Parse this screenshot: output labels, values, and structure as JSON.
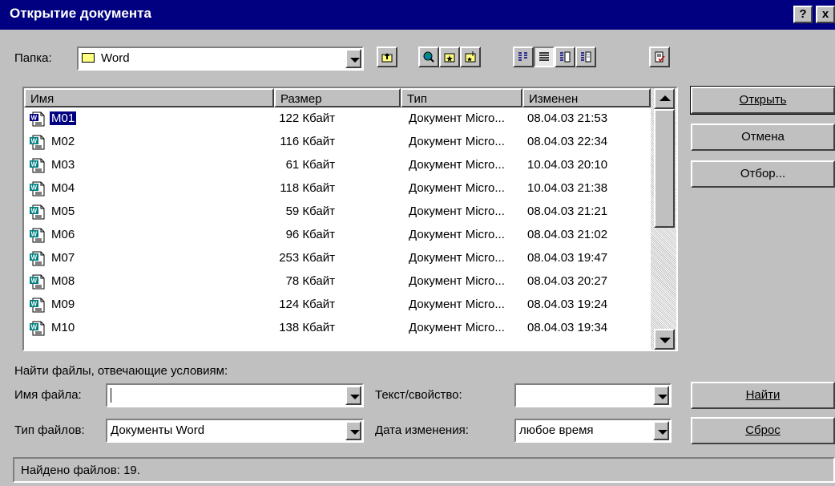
{
  "window": {
    "title": "Открытие документа",
    "help_label": "?",
    "close_label": "x"
  },
  "folder": {
    "label": "Папка:",
    "value": "Word"
  },
  "toolbar": {
    "icons": [
      "up-one-level-icon",
      "search-web-icon",
      "look-in-favorites-icon",
      "add-to-favorites-icon",
      "list-view-icon",
      "details-view-icon",
      "properties-view-icon",
      "preview-view-icon",
      "commands-settings-icon"
    ]
  },
  "file_list": {
    "headers": {
      "name": "Имя",
      "size": "Размер",
      "type": "Тип",
      "modified": "Изменен"
    },
    "rows": [
      {
        "name": "M01",
        "size": "122 Кбайт",
        "type": "Документ Micro...",
        "modified": "08.04.03 21:53",
        "selected": true
      },
      {
        "name": "M02",
        "size": "116 Кбайт",
        "type": "Документ Micro...",
        "modified": "08.04.03 22:34"
      },
      {
        "name": "M03",
        "size": "61 Кбайт",
        "type": "Документ Micro...",
        "modified": "10.04.03 20:10"
      },
      {
        "name": "M04",
        "size": "118 Кбайт",
        "type": "Документ Micro...",
        "modified": "10.04.03 21:38"
      },
      {
        "name": "M05",
        "size": "59 Кбайт",
        "type": "Документ Micro...",
        "modified": "08.04.03 21:21"
      },
      {
        "name": "M06",
        "size": "96 Кбайт",
        "type": "Документ Micro...",
        "modified": "08.04.03 21:02"
      },
      {
        "name": "M07",
        "size": "253 Кбайт",
        "type": "Документ Micro...",
        "modified": "08.04.03 19:47"
      },
      {
        "name": "M08",
        "size": "78 Кбайт",
        "type": "Документ Micro...",
        "modified": "08.04.03 20:27"
      },
      {
        "name": "M09",
        "size": "124 Кбайт",
        "type": "Документ Micro...",
        "modified": "08.04.03 19:24"
      },
      {
        "name": "M10",
        "size": "138 Кбайт",
        "type": "Документ Micro...",
        "modified": "08.04.03 19:34"
      }
    ]
  },
  "buttons": {
    "open": "Открыть",
    "cancel": "Отмена",
    "filter": "Отбор...",
    "find": "Найти",
    "reset": "Сброс"
  },
  "search": {
    "heading": "Найти файлы, отвечающие условиям:",
    "filename_label": "Имя файла:",
    "filename_value": "",
    "filetype_label": "Тип файлов:",
    "filetype_value": "Документы Word",
    "text_label": "Текст/свойство:",
    "text_value": "",
    "date_label": "Дата изменения:",
    "date_value": "любое время"
  },
  "status": {
    "text": "Найдено файлов: 19."
  },
  "colors": {
    "title_bar": "#000080",
    "face": "#c0c0c0",
    "selection": "#000080"
  }
}
